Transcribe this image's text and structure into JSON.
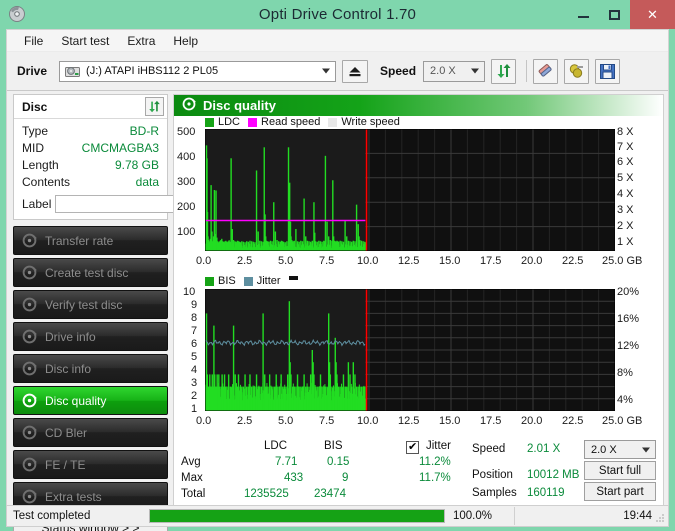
{
  "window": {
    "title": "Opti Drive Control 1.70",
    "icon": "disc-app-icon",
    "minimize": "minimize-icon",
    "maximize": "maximize-icon",
    "close": "close-icon"
  },
  "menu": {
    "items": [
      {
        "label": "File"
      },
      {
        "label": "Start test"
      },
      {
        "label": "Extra"
      },
      {
        "label": "Help"
      }
    ]
  },
  "toolbar": {
    "drive_label": "Drive",
    "drive_value": "(J:)  ATAPI iHBS112  2 PL05",
    "drive_icon": "drive-icon",
    "eject_icon": "eject-icon",
    "speed_label": "Speed",
    "speed_value": "2.0 X",
    "refresh_icon": "refresh-icon",
    "erase_icon": "erase-icon",
    "plug_icon": "plug-icon",
    "save_icon": "save-icon"
  },
  "disc_panel": {
    "title": "Disc",
    "refresh_icon": "refresh-icon",
    "rows": [
      {
        "key": "Type",
        "value": "BD-R"
      },
      {
        "key": "MID",
        "value": "CMCMAGBA3"
      },
      {
        "key": "Length",
        "value": "9.78 GB"
      },
      {
        "key": "Contents",
        "value": "data"
      }
    ],
    "label_key": "Label",
    "label_value": "",
    "label_placeholder": "",
    "cd_icon": "cd-disc-icon"
  },
  "tests": {
    "items": [
      {
        "label": "Transfer rate",
        "icon": "disc-test-icon",
        "active": false
      },
      {
        "label": "Create test disc",
        "icon": "disc-test-icon",
        "active": false
      },
      {
        "label": "Verify test disc",
        "icon": "disc-test-icon",
        "active": false
      },
      {
        "label": "Drive info",
        "icon": "disc-test-icon",
        "active": false
      },
      {
        "label": "Disc info",
        "icon": "disc-test-icon",
        "active": false
      },
      {
        "label": "Disc quality",
        "icon": "disc-test-icon",
        "active": true
      },
      {
        "label": "CD Bler",
        "icon": "disc-test-icon",
        "active": false
      },
      {
        "label": "FE / TE",
        "icon": "disc-test-icon",
        "active": false
      },
      {
        "label": "Extra tests",
        "icon": "disc-test-icon",
        "active": false
      }
    ],
    "status_window_label": "Status window > >"
  },
  "panel": {
    "header_title": "Disc quality",
    "header_icon": "disc-quality-icon"
  },
  "stats": {
    "col_ldc": "LDC",
    "col_bis": "BIS",
    "jitter_label": "Jitter",
    "jitter_checked": true,
    "rows": [
      {
        "label": "Avg",
        "ldc": "7.71",
        "bis": "0.15",
        "jitter": "11.2%"
      },
      {
        "label": "Max",
        "ldc": "433",
        "bis": "9",
        "jitter": "11.7%"
      },
      {
        "label": "Total",
        "ldc": "1235525",
        "bis": "23474",
        "jitter": ""
      }
    ],
    "speed_label": "Speed",
    "speed_value": "2.01 X",
    "position_label": "Position",
    "position_value": "10012 MB",
    "samples_label": "Samples",
    "samples_value": "160119",
    "speed_select": "2.0 X",
    "start_full": "Start full",
    "start_part": "Start part"
  },
  "statusbar": {
    "text": "Test completed",
    "percent": "100.0%",
    "progress": 100,
    "time": "19:44"
  },
  "colors": {
    "accent_green": "#19b319",
    "titlebar": "#7fd6ad",
    "close_red": "#c55a5a",
    "ldc_green": "#22dd22",
    "read_speed_magenta": "#ff00ff",
    "write_speed_gray": "#e8e8e8",
    "bis_green": "#22dd22",
    "jitter_blue": "#5e8fa0",
    "value_green": "#0a8a3a",
    "end_marker_red": "#ff0000",
    "plot_bg": "#0d0d0d"
  },
  "chart_data": [
    {
      "type": "bar",
      "name": "ldc-chart",
      "title": "",
      "legend": [
        {
          "label": "LDC",
          "color": "#22dd22"
        },
        {
          "label": "Read speed",
          "color": "#ff00ff"
        },
        {
          "label": "Write speed",
          "color": "#e8e8e8"
        }
      ],
      "legend_position": "top-left",
      "xlabel": "GB",
      "ylabel": "",
      "xlim": [
        0,
        25
      ],
      "ylim": [
        0,
        500
      ],
      "xticks": [
        "0.0",
        "2.5",
        "5.0",
        "7.5",
        "10.0",
        "12.5",
        "15.0",
        "17.5",
        "20.0",
        "22.5",
        "25.0 GB"
      ],
      "yticks": [
        "100",
        "200",
        "300",
        "400",
        "500"
      ],
      "y2lim": [
        0,
        8
      ],
      "y2ticks": [
        "1 X",
        "2 X",
        "3 X",
        "4 X",
        "5 X",
        "6 X",
        "7 X",
        "8 X"
      ],
      "grid": true,
      "data_end_x": 9.78,
      "end_marker_x": 9.85,
      "read_speed_level": 2.0,
      "series": [
        {
          "name": "LDC",
          "color": "#22dd22",
          "x": [
            0.02,
            0.05,
            0.08,
            0.11,
            0.14,
            0.17,
            0.2,
            0.24,
            0.28,
            0.33,
            0.38,
            0.43,
            0.48,
            0.53,
            0.58,
            0.63,
            0.68,
            0.73,
            0.78,
            0.83,
            0.88,
            0.93,
            0.98,
            1.03,
            1.08,
            1.13,
            1.18,
            1.23,
            1.28,
            1.33,
            1.38,
            1.43,
            1.48,
            1.55,
            1.62,
            1.7,
            1.78,
            1.86,
            1.94,
            2.0,
            2.06,
            2.12,
            2.2,
            2.3,
            2.4,
            2.5,
            2.6,
            2.7,
            2.8,
            2.9,
            3.0,
            3.1,
            3.2,
            3.3,
            3.4,
            3.5,
            3.57,
            3.62,
            3.66,
            3.7,
            3.78,
            3.86,
            3.95,
            4.05,
            4.15,
            4.25,
            4.35,
            4.45,
            4.55,
            4.62,
            4.68,
            4.75,
            4.85,
            4.95,
            5.05,
            5.12,
            5.17,
            5.2,
            5.25,
            5.32,
            5.4,
            5.5,
            5.6,
            5.7,
            5.8,
            5.9,
            6.0,
            6.1,
            6.2,
            6.3,
            6.4,
            6.5,
            6.6,
            6.65,
            6.7,
            6.8,
            6.9,
            7.0,
            7.1,
            7.2,
            7.25,
            7.3,
            7.4,
            7.5,
            7.6,
            7.7,
            7.75,
            7.8,
            7.85,
            7.9,
            7.95,
            8.0,
            8.05,
            8.1,
            8.2,
            8.3,
            8.4,
            8.5,
            8.6,
            8.7,
            8.8,
            8.9,
            9.0,
            9.1,
            9.2,
            9.3,
            9.35,
            9.4,
            9.5,
            9.6,
            9.7,
            9.78
          ],
          "y": [
            30,
            433,
            380,
            160,
            60,
            45,
            40,
            35,
            50,
            270,
            80,
            40,
            60,
            250,
            70,
            248,
            55,
            40,
            35,
            38,
            42,
            45,
            50,
            40,
            38,
            36,
            40,
            42,
            38,
            36,
            40,
            44,
            38,
            380,
            90,
            45,
            40,
            38,
            42,
            40,
            38,
            36,
            40,
            38,
            36,
            40,
            38,
            42,
            40,
            38,
            36,
            330,
            80,
            42,
            40,
            38,
            425,
            150,
            60,
            42,
            40,
            38,
            42,
            40,
            200,
            80,
            45,
            40,
            38,
            42,
            40,
            38,
            36,
            40,
            425,
            280,
            120,
            60,
            45,
            40,
            42,
            90,
            40,
            38,
            42,
            40,
            215,
            60,
            42,
            40,
            38,
            42,
            200,
            75,
            40,
            38,
            42,
            40,
            38,
            42,
            40,
            390,
            120,
            60,
            45,
            42,
            290,
            60,
            42,
            40,
            38,
            42,
            40,
            38,
            42,
            40,
            38,
            125,
            60,
            42,
            40,
            38,
            42,
            40,
            190,
            110,
            60,
            45,
            42,
            40,
            38,
            35
          ]
        },
        {
          "name": "Read speed",
          "color": "#ff00ff",
          "constant_value": 2.0,
          "x_range": [
            0.05,
            9.78
          ]
        }
      ]
    },
    {
      "type": "bar",
      "name": "bis-chart",
      "title": "",
      "legend": [
        {
          "label": "BIS",
          "color": "#22dd22"
        },
        {
          "label": "Jitter",
          "color": "#5e8fa0"
        }
      ],
      "legend_position": "top-left",
      "xlabel": "GB",
      "ylabel": "",
      "xlim": [
        0,
        25
      ],
      "ylim": [
        0,
        10
      ],
      "xticks": [
        "0.0",
        "2.5",
        "5.0",
        "7.5",
        "10.0",
        "12.5",
        "15.0",
        "17.5",
        "20.0",
        "22.5",
        "25.0 GB"
      ],
      "yticks": [
        "1",
        "2",
        "3",
        "4",
        "5",
        "6",
        "7",
        "8",
        "9",
        "10"
      ],
      "y2lim": [
        0,
        20
      ],
      "y2ticks": [
        "4%",
        "8%",
        "12%",
        "16%",
        "20%"
      ],
      "grid": true,
      "data_end_x": 9.78,
      "end_marker_x": 9.85,
      "series": [
        {
          "name": "BIS",
          "color": "#22dd22",
          "x": [
            0.02,
            0.05,
            0.1,
            0.15,
            0.2,
            0.25,
            0.3,
            0.35,
            0.4,
            0.45,
            0.5,
            0.55,
            0.6,
            0.65,
            0.7,
            0.75,
            0.8,
            0.85,
            0.9,
            0.95,
            1.0,
            1.05,
            1.1,
            1.15,
            1.2,
            1.3,
            1.4,
            1.5,
            1.6,
            1.7,
            1.8,
            1.9,
            1.95,
            2.0,
            2.1,
            2.2,
            2.3,
            2.4,
            2.5,
            2.6,
            2.7,
            2.8,
            2.9,
            3.0,
            3.1,
            3.2,
            3.3,
            3.4,
            3.5,
            3.6,
            3.65,
            3.7,
            3.8,
            3.9,
            4.0,
            4.1,
            4.2,
            4.3,
            4.4,
            4.5,
            4.6,
            4.7,
            4.8,
            4.9,
            5.0,
            5.1,
            5.15,
            5.2,
            5.3,
            5.4,
            5.5,
            5.6,
            5.7,
            5.8,
            5.9,
            6.0,
            6.1,
            6.2,
            6.3,
            6.4,
            6.5,
            6.55,
            6.6,
            6.7,
            6.8,
            6.9,
            7.0,
            7.1,
            7.2,
            7.3,
            7.4,
            7.5,
            7.55,
            7.6,
            7.7,
            7.8,
            7.9,
            7.95,
            8.0,
            8.1,
            8.2,
            8.3,
            8.4,
            8.5,
            8.6,
            8.7,
            8.8,
            8.9,
            9.0,
            9.1,
            9.2,
            9.3,
            9.4,
            9.5,
            9.6,
            9.7,
            9.78
          ],
          "y": [
            2,
            8,
            3,
            2,
            2,
            3,
            2,
            2,
            3,
            2,
            7,
            3,
            2,
            2,
            3,
            2,
            3,
            2,
            1,
            2,
            3,
            2,
            2,
            3,
            2,
            2,
            3,
            2,
            2,
            7,
            3,
            2,
            2,
            3,
            2,
            2,
            2,
            3,
            2,
            2,
            3,
            2,
            2,
            2,
            3,
            2,
            2,
            2,
            8,
            3,
            2,
            2,
            2,
            3,
            2,
            2,
            2,
            3,
            2,
            2,
            3,
            2,
            2,
            2,
            3,
            9,
            4,
            3,
            2,
            2,
            2,
            3,
            2,
            2,
            2,
            3,
            2,
            2,
            2,
            3,
            5,
            4,
            3,
            2,
            2,
            2,
            3,
            2,
            2,
            2,
            2,
            8,
            4,
            3,
            2,
            2,
            6,
            4,
            3,
            2,
            2,
            2,
            3,
            2,
            2,
            4,
            3,
            2,
            4,
            3,
            2,
            2,
            2,
            2,
            2,
            2,
            1
          ]
        },
        {
          "name": "Jitter",
          "color": "#5e8fa0",
          "approx_level_percent": 11.2,
          "x_range": [
            0.05,
            9.78
          ]
        }
      ]
    }
  ]
}
